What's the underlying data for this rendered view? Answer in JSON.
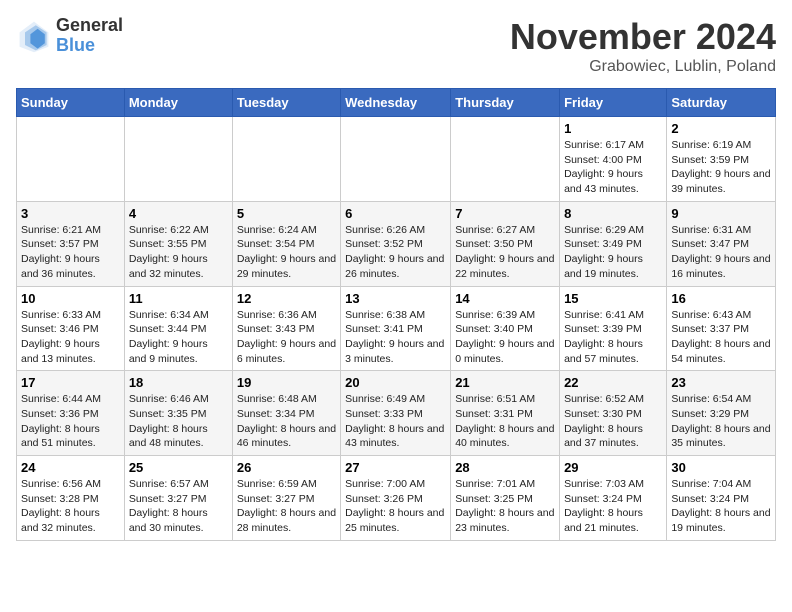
{
  "logo": {
    "general": "General",
    "blue": "Blue"
  },
  "title": "November 2024",
  "location": "Grabowiec, Lublin, Poland",
  "headers": [
    "Sunday",
    "Monday",
    "Tuesday",
    "Wednesday",
    "Thursday",
    "Friday",
    "Saturday"
  ],
  "weeks": [
    [
      {
        "day": "",
        "info": ""
      },
      {
        "day": "",
        "info": ""
      },
      {
        "day": "",
        "info": ""
      },
      {
        "day": "",
        "info": ""
      },
      {
        "day": "",
        "info": ""
      },
      {
        "day": "1",
        "info": "Sunrise: 6:17 AM\nSunset: 4:00 PM\nDaylight: 9 hours and 43 minutes."
      },
      {
        "day": "2",
        "info": "Sunrise: 6:19 AM\nSunset: 3:59 PM\nDaylight: 9 hours and 39 minutes."
      }
    ],
    [
      {
        "day": "3",
        "info": "Sunrise: 6:21 AM\nSunset: 3:57 PM\nDaylight: 9 hours and 36 minutes."
      },
      {
        "day": "4",
        "info": "Sunrise: 6:22 AM\nSunset: 3:55 PM\nDaylight: 9 hours and 32 minutes."
      },
      {
        "day": "5",
        "info": "Sunrise: 6:24 AM\nSunset: 3:54 PM\nDaylight: 9 hours and 29 minutes."
      },
      {
        "day": "6",
        "info": "Sunrise: 6:26 AM\nSunset: 3:52 PM\nDaylight: 9 hours and 26 minutes."
      },
      {
        "day": "7",
        "info": "Sunrise: 6:27 AM\nSunset: 3:50 PM\nDaylight: 9 hours and 22 minutes."
      },
      {
        "day": "8",
        "info": "Sunrise: 6:29 AM\nSunset: 3:49 PM\nDaylight: 9 hours and 19 minutes."
      },
      {
        "day": "9",
        "info": "Sunrise: 6:31 AM\nSunset: 3:47 PM\nDaylight: 9 hours and 16 minutes."
      }
    ],
    [
      {
        "day": "10",
        "info": "Sunrise: 6:33 AM\nSunset: 3:46 PM\nDaylight: 9 hours and 13 minutes."
      },
      {
        "day": "11",
        "info": "Sunrise: 6:34 AM\nSunset: 3:44 PM\nDaylight: 9 hours and 9 minutes."
      },
      {
        "day": "12",
        "info": "Sunrise: 6:36 AM\nSunset: 3:43 PM\nDaylight: 9 hours and 6 minutes."
      },
      {
        "day": "13",
        "info": "Sunrise: 6:38 AM\nSunset: 3:41 PM\nDaylight: 9 hours and 3 minutes."
      },
      {
        "day": "14",
        "info": "Sunrise: 6:39 AM\nSunset: 3:40 PM\nDaylight: 9 hours and 0 minutes."
      },
      {
        "day": "15",
        "info": "Sunrise: 6:41 AM\nSunset: 3:39 PM\nDaylight: 8 hours and 57 minutes."
      },
      {
        "day": "16",
        "info": "Sunrise: 6:43 AM\nSunset: 3:37 PM\nDaylight: 8 hours and 54 minutes."
      }
    ],
    [
      {
        "day": "17",
        "info": "Sunrise: 6:44 AM\nSunset: 3:36 PM\nDaylight: 8 hours and 51 minutes."
      },
      {
        "day": "18",
        "info": "Sunrise: 6:46 AM\nSunset: 3:35 PM\nDaylight: 8 hours and 48 minutes."
      },
      {
        "day": "19",
        "info": "Sunrise: 6:48 AM\nSunset: 3:34 PM\nDaylight: 8 hours and 46 minutes."
      },
      {
        "day": "20",
        "info": "Sunrise: 6:49 AM\nSunset: 3:33 PM\nDaylight: 8 hours and 43 minutes."
      },
      {
        "day": "21",
        "info": "Sunrise: 6:51 AM\nSunset: 3:31 PM\nDaylight: 8 hours and 40 minutes."
      },
      {
        "day": "22",
        "info": "Sunrise: 6:52 AM\nSunset: 3:30 PM\nDaylight: 8 hours and 37 minutes."
      },
      {
        "day": "23",
        "info": "Sunrise: 6:54 AM\nSunset: 3:29 PM\nDaylight: 8 hours and 35 minutes."
      }
    ],
    [
      {
        "day": "24",
        "info": "Sunrise: 6:56 AM\nSunset: 3:28 PM\nDaylight: 8 hours and 32 minutes."
      },
      {
        "day": "25",
        "info": "Sunrise: 6:57 AM\nSunset: 3:27 PM\nDaylight: 8 hours and 30 minutes."
      },
      {
        "day": "26",
        "info": "Sunrise: 6:59 AM\nSunset: 3:27 PM\nDaylight: 8 hours and 28 minutes."
      },
      {
        "day": "27",
        "info": "Sunrise: 7:00 AM\nSunset: 3:26 PM\nDaylight: 8 hours and 25 minutes."
      },
      {
        "day": "28",
        "info": "Sunrise: 7:01 AM\nSunset: 3:25 PM\nDaylight: 8 hours and 23 minutes."
      },
      {
        "day": "29",
        "info": "Sunrise: 7:03 AM\nSunset: 3:24 PM\nDaylight: 8 hours and 21 minutes."
      },
      {
        "day": "30",
        "info": "Sunrise: 7:04 AM\nSunset: 3:24 PM\nDaylight: 8 hours and 19 minutes."
      }
    ]
  ]
}
